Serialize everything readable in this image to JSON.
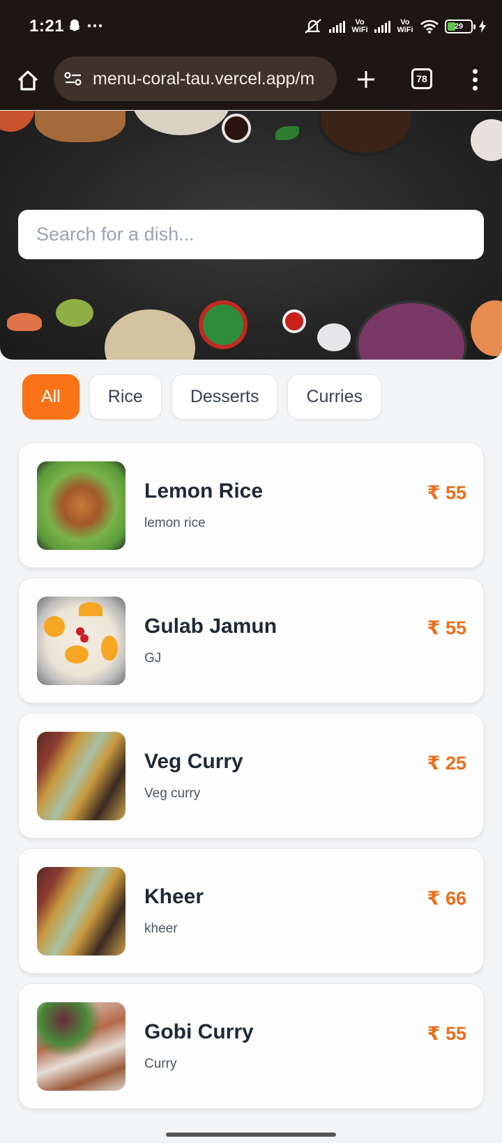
{
  "status_bar": {
    "time": "1:21",
    "battery": "29"
  },
  "browser": {
    "url": "menu-coral-tau.vercel.app/m",
    "tab_count": "78"
  },
  "search": {
    "placeholder": "Search for a dish..."
  },
  "categories": [
    {
      "label": "All",
      "active": true
    },
    {
      "label": "Rice",
      "active": false
    },
    {
      "label": "Desserts",
      "active": false
    },
    {
      "label": "Curries",
      "active": false
    }
  ],
  "dishes": [
    {
      "name": "Lemon Rice",
      "description": "lemon rice",
      "price": "₹ 55"
    },
    {
      "name": "Gulab Jamun",
      "description": "GJ",
      "price": "₹ 55"
    },
    {
      "name": "Veg Curry",
      "description": "Veg curry",
      "price": "₹ 25"
    },
    {
      "name": "Kheer",
      "description": "kheer",
      "price": "₹ 66"
    },
    {
      "name": "Gobi Curry",
      "description": "Curry",
      "price": "₹ 55"
    }
  ],
  "colors": {
    "accent": "#f97316",
    "price": "#ea6f1b",
    "browser_chrome": "#1d1613"
  }
}
